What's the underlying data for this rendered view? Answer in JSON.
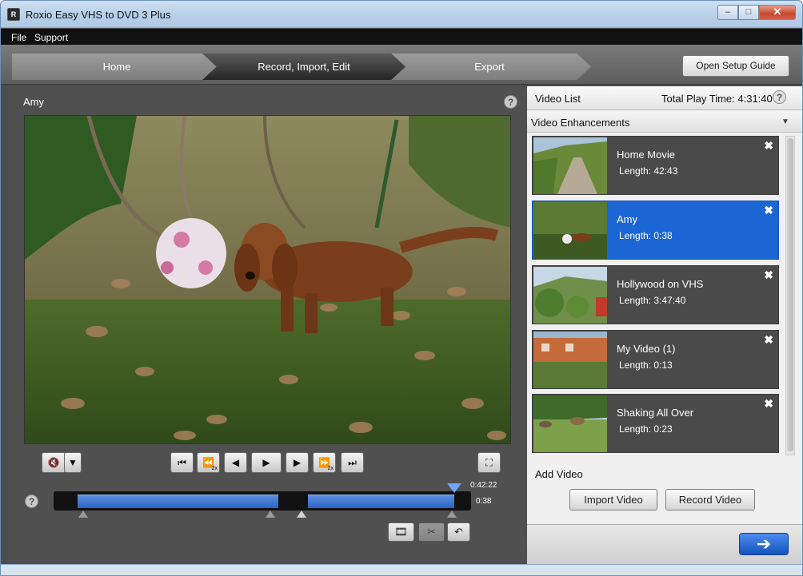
{
  "window": {
    "title": "Roxio Easy VHS to DVD 3 Plus",
    "app_icon": "roxio-app-icon",
    "minimize": "–",
    "maximize": "□",
    "close": "✕"
  },
  "menu": [
    "File",
    "Support"
  ],
  "nav": {
    "steps": [
      "Home",
      "Record, Import, Edit",
      "Export"
    ],
    "active_step": "Record, Import, Edit",
    "setup_button": "Open Setup Guide"
  },
  "player": {
    "clip_title": "Amy",
    "help": "?",
    "controls": {
      "mute": "🔇",
      "dropdown": "▼",
      "skip_start": "⏮",
      "rewind": "⏪",
      "rewind_speed": "2x",
      "step_back": "◀",
      "play": "▶",
      "step_forward": "▶",
      "fast_forward": "⏩",
      "fast_forward_speed": "2x",
      "skip_end": "⏭",
      "fullscreen": "⛶"
    },
    "timeline": {
      "total": "0:42:22",
      "current": "0:38",
      "position": 0.96,
      "scenes": [
        [
          0.057,
          0.538
        ],
        [
          0.61,
          0.96
        ]
      ]
    },
    "edit_buttons": [
      "🎞",
      "✂",
      "↶"
    ]
  },
  "video_list": {
    "header": "Video List",
    "total_play_time": "Total Play Time: 4:31:40",
    "enhancements": "Video Enhancements",
    "items": [
      {
        "name": "Home Movie",
        "length": "Length: 42:43",
        "selected": false
      },
      {
        "name": "Amy",
        "length": "Length: 0:38",
        "selected": true
      },
      {
        "name": "Hollywood on VHS",
        "length": "Length: 3:47:40",
        "selected": false
      },
      {
        "name": "My Video (1)",
        "length": "Length: 0:13",
        "selected": false
      },
      {
        "name": "Shaking All Over",
        "length": "Length: 0:23",
        "selected": false
      }
    ],
    "remove_glyph": "✖"
  },
  "add_video": {
    "label": "Add Video",
    "import": "Import Video",
    "record": "Record Video"
  },
  "next": "➔",
  "colors": {
    "accent": "#1b66d4",
    "panel": "#4a4a4a",
    "nav_active": "#262626"
  }
}
